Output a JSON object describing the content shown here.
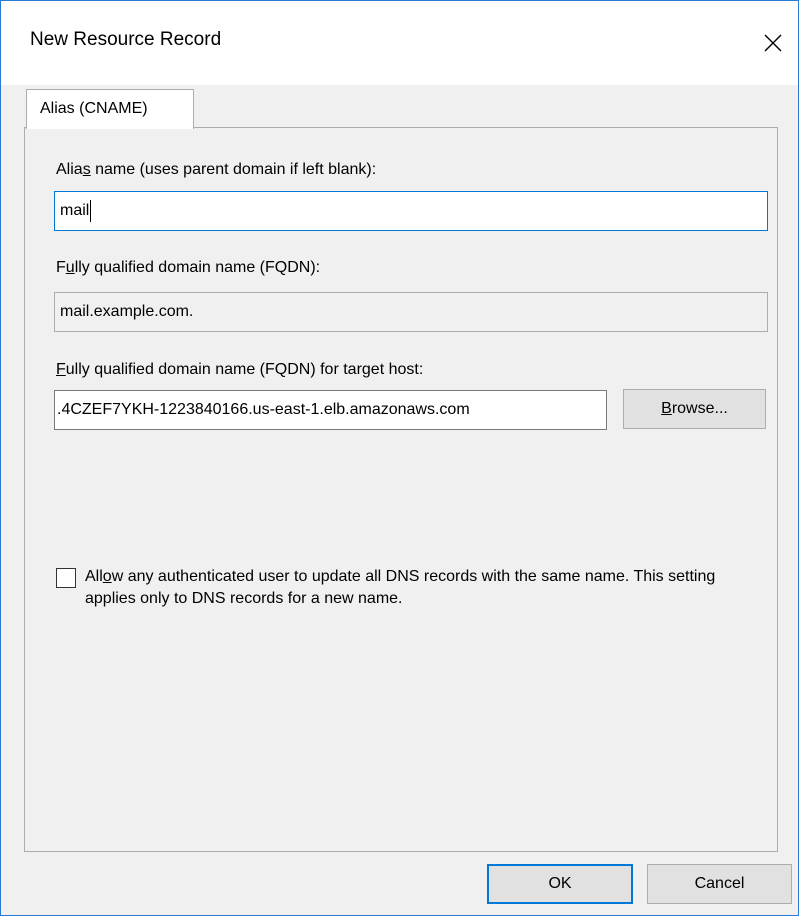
{
  "dialog": {
    "title": "New Resource Record",
    "close_icon": "close-icon"
  },
  "tabs": [
    {
      "label": "Alias (CNAME)",
      "selected": true
    }
  ],
  "alias": {
    "label_before": "Alia",
    "label_access_key": "s",
    "label_after": " name (uses parent domain if left blank):",
    "value": "mail"
  },
  "fqdn": {
    "label_before": "F",
    "label_access_key": "u",
    "label_after": "lly qualified domain name (FQDN):",
    "value": "mail.example.com."
  },
  "target": {
    "label_access_key": "F",
    "label_after": "ully qualified domain name (FQDN) for target host:",
    "value": ".4CZEF7YKH-1223840166.us-east-1.elb.amazonaws.com",
    "browse_label": "Browse...",
    "browse_access_key": "B",
    "browse_rest": "rowse..."
  },
  "permission": {
    "checked": false,
    "label_before": "All",
    "label_access_key": "o",
    "label_after": "w any authenticated user to update all DNS records with the same name. This setting applies only to DNS records for a new name."
  },
  "footer": {
    "ok_label": "OK",
    "cancel_label": "Cancel"
  },
  "colors": {
    "accent": "#0078d7",
    "window_border": "#2b79d6",
    "dialog_bg": "#f0f0f0"
  }
}
